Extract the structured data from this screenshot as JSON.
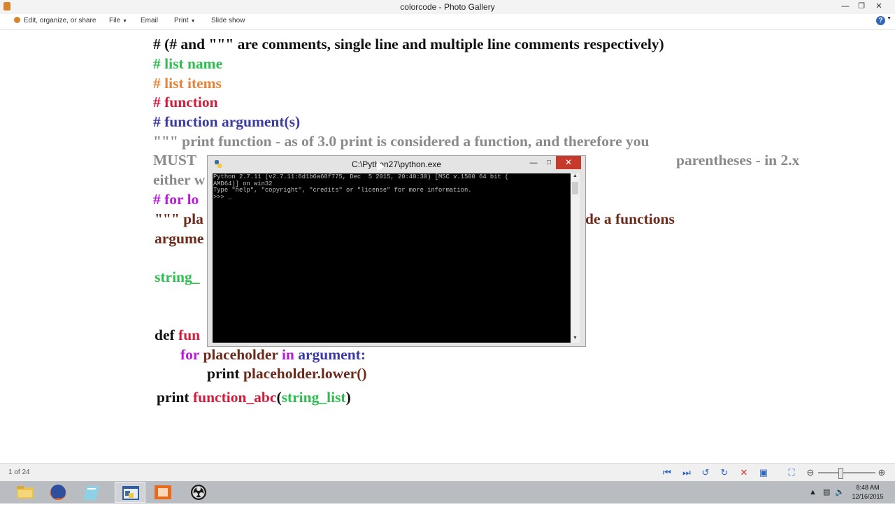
{
  "window": {
    "title": "colorcode - Photo Gallery"
  },
  "menu": {
    "organize": "Edit, organize, or share",
    "file": "File",
    "email": "Email",
    "print": "Print",
    "slideshow": "Slide show",
    "help": "?"
  },
  "document": {
    "lines": [
      {
        "segments": [
          {
            "text": "# (# and \"\"\" are comments, single line and multiple line comments respectively)",
            "color": "black"
          }
        ]
      },
      {
        "segments": [
          {
            "text": "# list name",
            "color": "green"
          }
        ]
      },
      {
        "segments": [
          {
            "text": "# list items",
            "color": "orange"
          }
        ]
      },
      {
        "segments": [
          {
            "text": "# function",
            "color": "red"
          }
        ]
      },
      {
        "segments": [
          {
            "text": "# function argument(s)",
            "color": "blue"
          }
        ]
      },
      {
        "segments": [
          {
            "text": "\"\"\" print function - as of 3.0 print is considered a function, and therefore you",
            "color": "gray"
          }
        ]
      },
      {
        "segments": [
          {
            "text": "MUST ",
            "color": "gray"
          },
          {
            "text": "parentheses - in 2.x",
            "color": "gray",
            "offset": 2
          }
        ]
      },
      {
        "segments": [
          {
            "text": "either w",
            "color": "gray"
          }
        ]
      },
      {
        "segments": [
          {
            "text": "# for lo",
            "color": "magenta"
          }
        ]
      },
      {
        "segments": [
          {
            "text": "\"\"\" pla",
            "color": "brown"
          },
          {
            "text": "de a functions",
            "color": "brown",
            "offset": 2
          }
        ]
      },
      {
        "segments": [
          {
            "text": "argume",
            "color": "brown"
          }
        ]
      },
      {
        "segments": [
          {
            "text": "string_",
            "color": "green"
          }
        ]
      },
      {
        "segments": [
          {
            "text": "def ",
            "color": "black"
          },
          {
            "text": "fun",
            "color": "red"
          }
        ]
      },
      {
        "segments": [
          {
            "text": "for ",
            "color": "magenta"
          },
          {
            "text": "placeholder ",
            "color": "brown"
          },
          {
            "text": "in ",
            "color": "magenta"
          },
          {
            "text": "argument:",
            "color": "blue"
          }
        ]
      },
      {
        "segments": [
          {
            "text": "print ",
            "color": "black"
          },
          {
            "text": "placeholder.lower()",
            "color": "brown"
          }
        ]
      },
      {
        "segments": [
          {
            "text": "print ",
            "color": "black"
          },
          {
            "text": "function_abc",
            "color": "red"
          },
          {
            "text": "(",
            "color": "black"
          },
          {
            "text": "string_list",
            "color": "green"
          },
          {
            "text": ")",
            "color": "black"
          }
        ]
      }
    ]
  },
  "console": {
    "title": "C:\\Python27\\python.exe",
    "lines": [
      "Python 2.7.11 (v2.7.11:6d1b6a68f775, Dec  5 2015, 20:40:30) [MSC v.1500 64 bit (",
      "AMD64)] on win32",
      "Type \"help\", \"copyright\", \"credits\" or \"license\" for more information.",
      ">>> _"
    ]
  },
  "status": {
    "count": "1 of 24",
    "zoom_level": 0.35
  },
  "taskbar": {
    "apps": [
      "file-explorer",
      "firefox",
      "notepad",
      "python",
      "installer",
      "obs"
    ],
    "time": "8:48 AM",
    "date": "12/16/2015"
  },
  "colors": {
    "black": "#111111",
    "green": "#2ebd4f",
    "orange": "#e8843a",
    "red": "#d71a3a",
    "blue": "#3a3aa5",
    "gray": "#8a8a8a",
    "magenta": "#b81ad8",
    "brown": "#6b2a1a",
    "close_red": "#c7392b",
    "accent_blue": "#2a63c0"
  }
}
